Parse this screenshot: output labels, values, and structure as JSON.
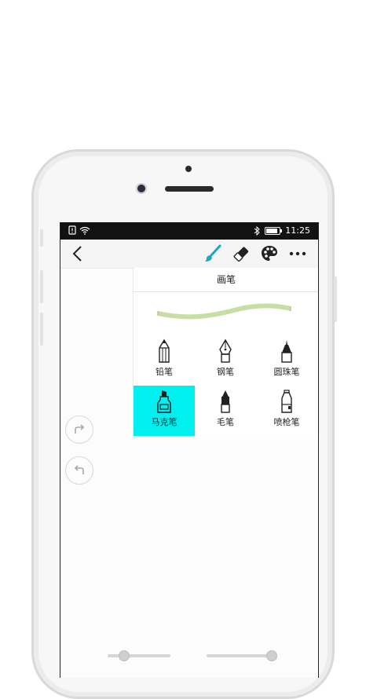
{
  "status_bar": {
    "time": "11:25"
  },
  "toolbar": {
    "back_icon": "chevron-left-icon",
    "brush_icon": "paintbrush-icon",
    "eraser_icon": "eraser-icon",
    "palette_icon": "palette-icon",
    "more_icon": "more-horizontal-icon",
    "accent_color": "#1aa6c4"
  },
  "brush_panel": {
    "title": "画笔",
    "stroke_preview_color": "#c8dfa4",
    "brushes": [
      {
        "label": "铅笔",
        "icon": "pencil-icon"
      },
      {
        "label": "钢笔",
        "icon": "fountain-pen-icon"
      },
      {
        "label": "圆珠笔",
        "icon": "ballpoint-pen-icon"
      },
      {
        "label": "马克笔",
        "icon": "marker-icon",
        "selected": true
      },
      {
        "label": "毛笔",
        "icon": "brush-pen-icon"
      },
      {
        "label": "喷枪笔",
        "icon": "airbrush-icon"
      }
    ],
    "selected_color": "#00f0f0"
  },
  "side_controls": {
    "redo_icon": "redo-icon",
    "undo_icon": "undo-icon"
  },
  "bottom_sliders": {
    "left_level": 0.25,
    "right_level": 0.95
  }
}
